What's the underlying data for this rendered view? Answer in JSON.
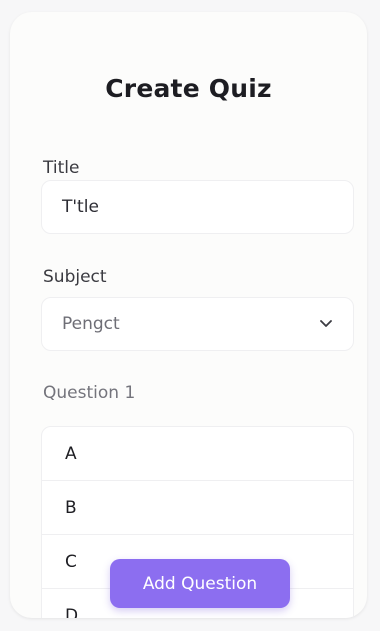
{
  "form": {
    "heading": "Create Quiz",
    "title_label": "Title",
    "title_value": "T'tle",
    "subject_label": "Subject",
    "subject_value": "Pengct",
    "question_label": "Question 1",
    "answers": [
      "A",
      "B",
      "C",
      "D"
    ],
    "add_button_label": "Add Question"
  },
  "icons": {
    "subject_dropdown": "chevron-down-icon"
  },
  "colors": {
    "accent": "#8c6ef0",
    "card_background": "#fcfcfb",
    "page_background": "#f7f7f8"
  }
}
